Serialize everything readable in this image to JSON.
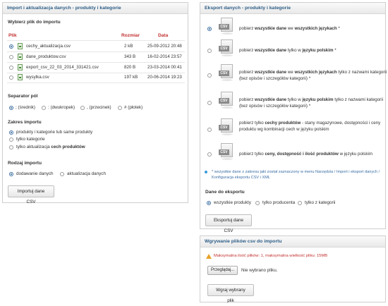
{
  "import_panel": {
    "title": "Import i aktualizacja danych - produkty i kategorie",
    "choose_file": "Wybierz plik do importu",
    "columns": {
      "file": "Plik",
      "size": "Rozmiar",
      "date": "Data"
    },
    "files": [
      {
        "name": "cechy_aktualizacja.csv",
        "size": "2 kB",
        "date": "25-09-2012 20:48",
        "selected": true
      },
      {
        "name": "dane_produktow.csv",
        "size": "343 B",
        "date": "16-02-2014 23:57",
        "selected": false
      },
      {
        "name": "export_csv_22_03_2014_331421.csv",
        "size": "820 B",
        "date": "23-03-2014 00:41",
        "selected": false
      },
      {
        "name": "wysylka.csv",
        "size": "197 kB",
        "date": "20-06-2014 19:23",
        "selected": false
      }
    ],
    "separator_title": "Separator pól",
    "separators": [
      {
        "label": "; (średnik)",
        "selected": true
      },
      {
        "label": ": (dwukropek)",
        "selected": false
      },
      {
        "label": ", (przecinek)",
        "selected": false
      },
      {
        "label": "# (płotek)",
        "selected": false
      }
    ],
    "scope_title": "Zakres importu",
    "scope": [
      {
        "label": "produkty i kategorie lub same produkty",
        "selected": true
      },
      {
        "label": "tylko kategorie",
        "selected": false
      },
      {
        "label_prefix": "tylko aktualizacja ",
        "label_bold": "cech produktów",
        "selected": false
      }
    ],
    "type_title": "Rodzaj importu",
    "types": [
      {
        "label": "dodawanie danych",
        "selected": true
      },
      {
        "label": "aktualizacja danych",
        "selected": false
      }
    ],
    "button": "Importuj dane CSV"
  },
  "export_panel": {
    "title": "Eksport danych - produkty i kategorie",
    "options": [
      {
        "text": "pobierz <b>wszystkie dane</b> we <b>wszystkich językach</b> *",
        "selected": true
      },
      {
        "text": "pobierz <b>wszystkie dane</b> tylko w <b>języku polskim</b> *",
        "selected": false
      },
      {
        "text": "pobierz <b>wszystkie dane</b> we <b>wszystkich językach</b> tylko z nazwami kategorii (bez opisów i szczegółów kategorii) *",
        "selected": false
      },
      {
        "text": "pobierz <b>wszystkie dane</b> tylko w <b>języku polskim</b> tylko z nazwami kategorii (bez opisów i szczegółów kategorii) *",
        "selected": false
      },
      {
        "text": "pobierz tylko <b>cechy produktów</b> - stany magazynowe, dostępności i ceny produktu wg kombinacji cech w języku polskim",
        "selected": false
      },
      {
        "text": "pobierz tylko <b>ceny, dostępność i ilość produktów</b> w języku polskim",
        "selected": false
      }
    ],
    "csv_label": "CSV",
    "note": "* wszystkie dane z zakresu jaki został zaznaczony w menu Narzędzia / Import i eksport danych / Konfiguracja eksportu CSV i XML",
    "data_title": "Dane do eksportu",
    "data_options": [
      {
        "label": "wszystkie produkty",
        "selected": true
      },
      {
        "label": "tylko producenta",
        "selected": false
      },
      {
        "label": "tylko z kategorii",
        "selected": false
      }
    ],
    "button": "Eksportuj dane CSV"
  },
  "upload_panel": {
    "title": "Wgrywanie plików csv do importu",
    "warning": "Maksymalna ilość plików: 1, maksymalna wielkość pliku: 15MB",
    "browse_button": "Przeglądaj...",
    "no_file": "Nie wybrano pliku.",
    "button": "Wgraj wybrany plik"
  }
}
